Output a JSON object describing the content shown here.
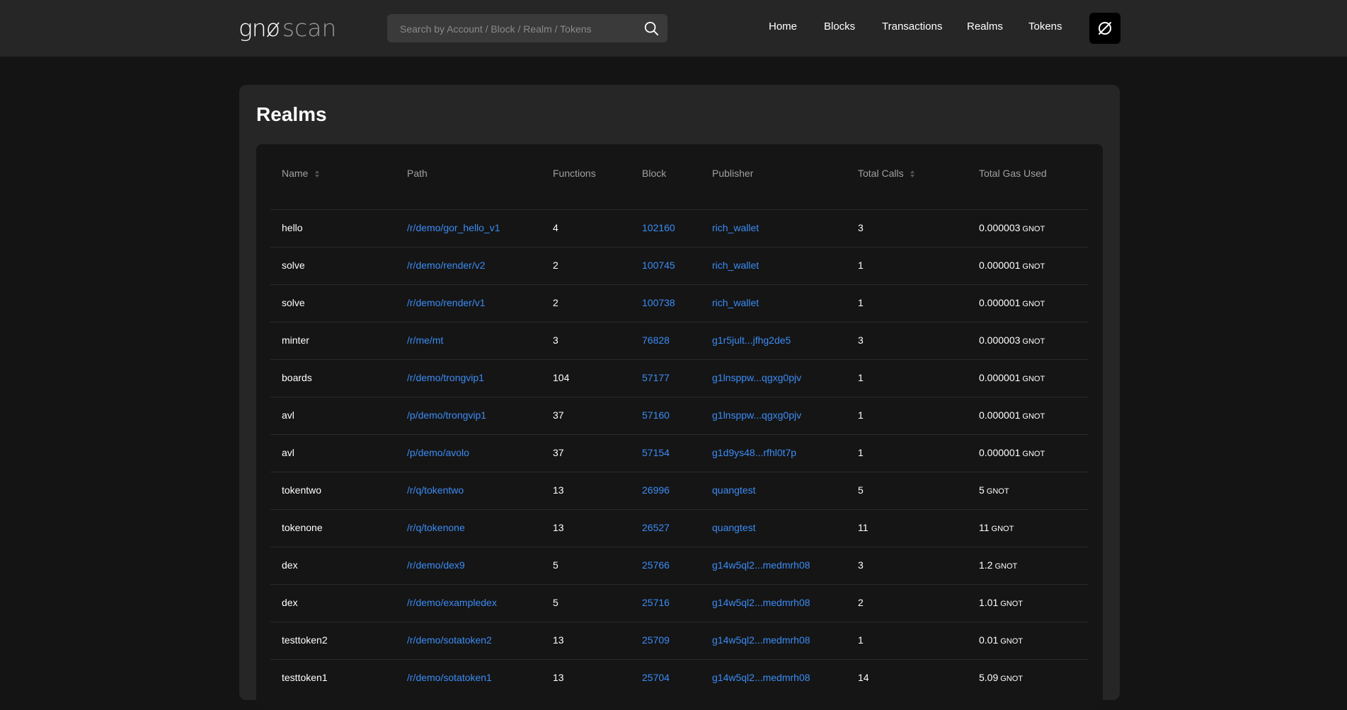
{
  "app": {
    "logo_text_1": "gnø",
    "logo_text_2": "scan"
  },
  "search": {
    "placeholder": "Search by Account / Block / Realm / Tokens"
  },
  "nav": {
    "home": "Home",
    "blocks": "Blocks",
    "transactions": "Transactions",
    "realms": "Realms",
    "tokens": "Tokens"
  },
  "page": {
    "title": "Realms"
  },
  "colors": {
    "background": "#141414",
    "header": "#262626",
    "card": "#262626",
    "table": "#151515",
    "link": "#3b8cf5"
  },
  "table": {
    "headers": {
      "name": "Name",
      "path": "Path",
      "functions": "Functions",
      "block": "Block",
      "publisher": "Publisher",
      "total_calls": "Total Calls",
      "total_gas_used": "Total Gas Used"
    },
    "rows": [
      {
        "name": "hello",
        "path": "/r/demo/gor_hello_v1",
        "functions": "4",
        "block": "102160",
        "publisher": "rich_wallet",
        "total_calls": "3",
        "gas": "0.000003",
        "unit": "GNOT"
      },
      {
        "name": "solve",
        "path": "/r/demo/render/v2",
        "functions": "2",
        "block": "100745",
        "publisher": "rich_wallet",
        "total_calls": "1",
        "gas": "0.000001",
        "unit": "GNOT"
      },
      {
        "name": "solve",
        "path": "/r/demo/render/v1",
        "functions": "2",
        "block": "100738",
        "publisher": "rich_wallet",
        "total_calls": "1",
        "gas": "0.000001",
        "unit": "GNOT"
      },
      {
        "name": "minter",
        "path": "/r/me/mt",
        "functions": "3",
        "block": "76828",
        "publisher": "g1r5jult...jfhg2de5",
        "total_calls": "3",
        "gas": "0.000003",
        "unit": "GNOT"
      },
      {
        "name": "boards",
        "path": "/r/demo/trongvip1",
        "functions": "104",
        "block": "57177",
        "publisher": "g1lnsppw...qgxg0pjv",
        "total_calls": "1",
        "gas": "0.000001",
        "unit": "GNOT"
      },
      {
        "name": "avl",
        "path": "/p/demo/trongvip1",
        "functions": "37",
        "block": "57160",
        "publisher": "g1lnsppw...qgxg0pjv",
        "total_calls": "1",
        "gas": "0.000001",
        "unit": "GNOT"
      },
      {
        "name": "avl",
        "path": "/p/demo/avolo",
        "functions": "37",
        "block": "57154",
        "publisher": "g1d9ys48...rfhl0t7p",
        "total_calls": "1",
        "gas": "0.000001",
        "unit": "GNOT"
      },
      {
        "name": "tokentwo",
        "path": "/r/q/tokentwo",
        "functions": "13",
        "block": "26996",
        "publisher": "quangtest",
        "total_calls": "5",
        "gas": "5",
        "unit": "GNOT"
      },
      {
        "name": "tokenone",
        "path": "/r/q/tokenone",
        "functions": "13",
        "block": "26527",
        "publisher": "quangtest",
        "total_calls": "11",
        "gas": "11",
        "unit": "GNOT"
      },
      {
        "name": "dex",
        "path": "/r/demo/dex9",
        "functions": "5",
        "block": "25766",
        "publisher": "g14w5ql2...medmrh08",
        "total_calls": "3",
        "gas": "1.2",
        "unit": "GNOT"
      },
      {
        "name": "dex",
        "path": "/r/demo/exampledex",
        "functions": "5",
        "block": "25716",
        "publisher": "g14w5ql2...medmrh08",
        "total_calls": "2",
        "gas": "1.01",
        "unit": "GNOT"
      },
      {
        "name": "testtoken2",
        "path": "/r/demo/sotatoken2",
        "functions": "13",
        "block": "25709",
        "publisher": "g14w5ql2...medmrh08",
        "total_calls": "1",
        "gas": "0.01",
        "unit": "GNOT"
      },
      {
        "name": "testtoken1",
        "path": "/r/demo/sotatoken1",
        "functions": "13",
        "block": "25704",
        "publisher": "g14w5ql2...medmrh08",
        "total_calls": "14",
        "gas": "5.09",
        "unit": "GNOT"
      }
    ]
  }
}
